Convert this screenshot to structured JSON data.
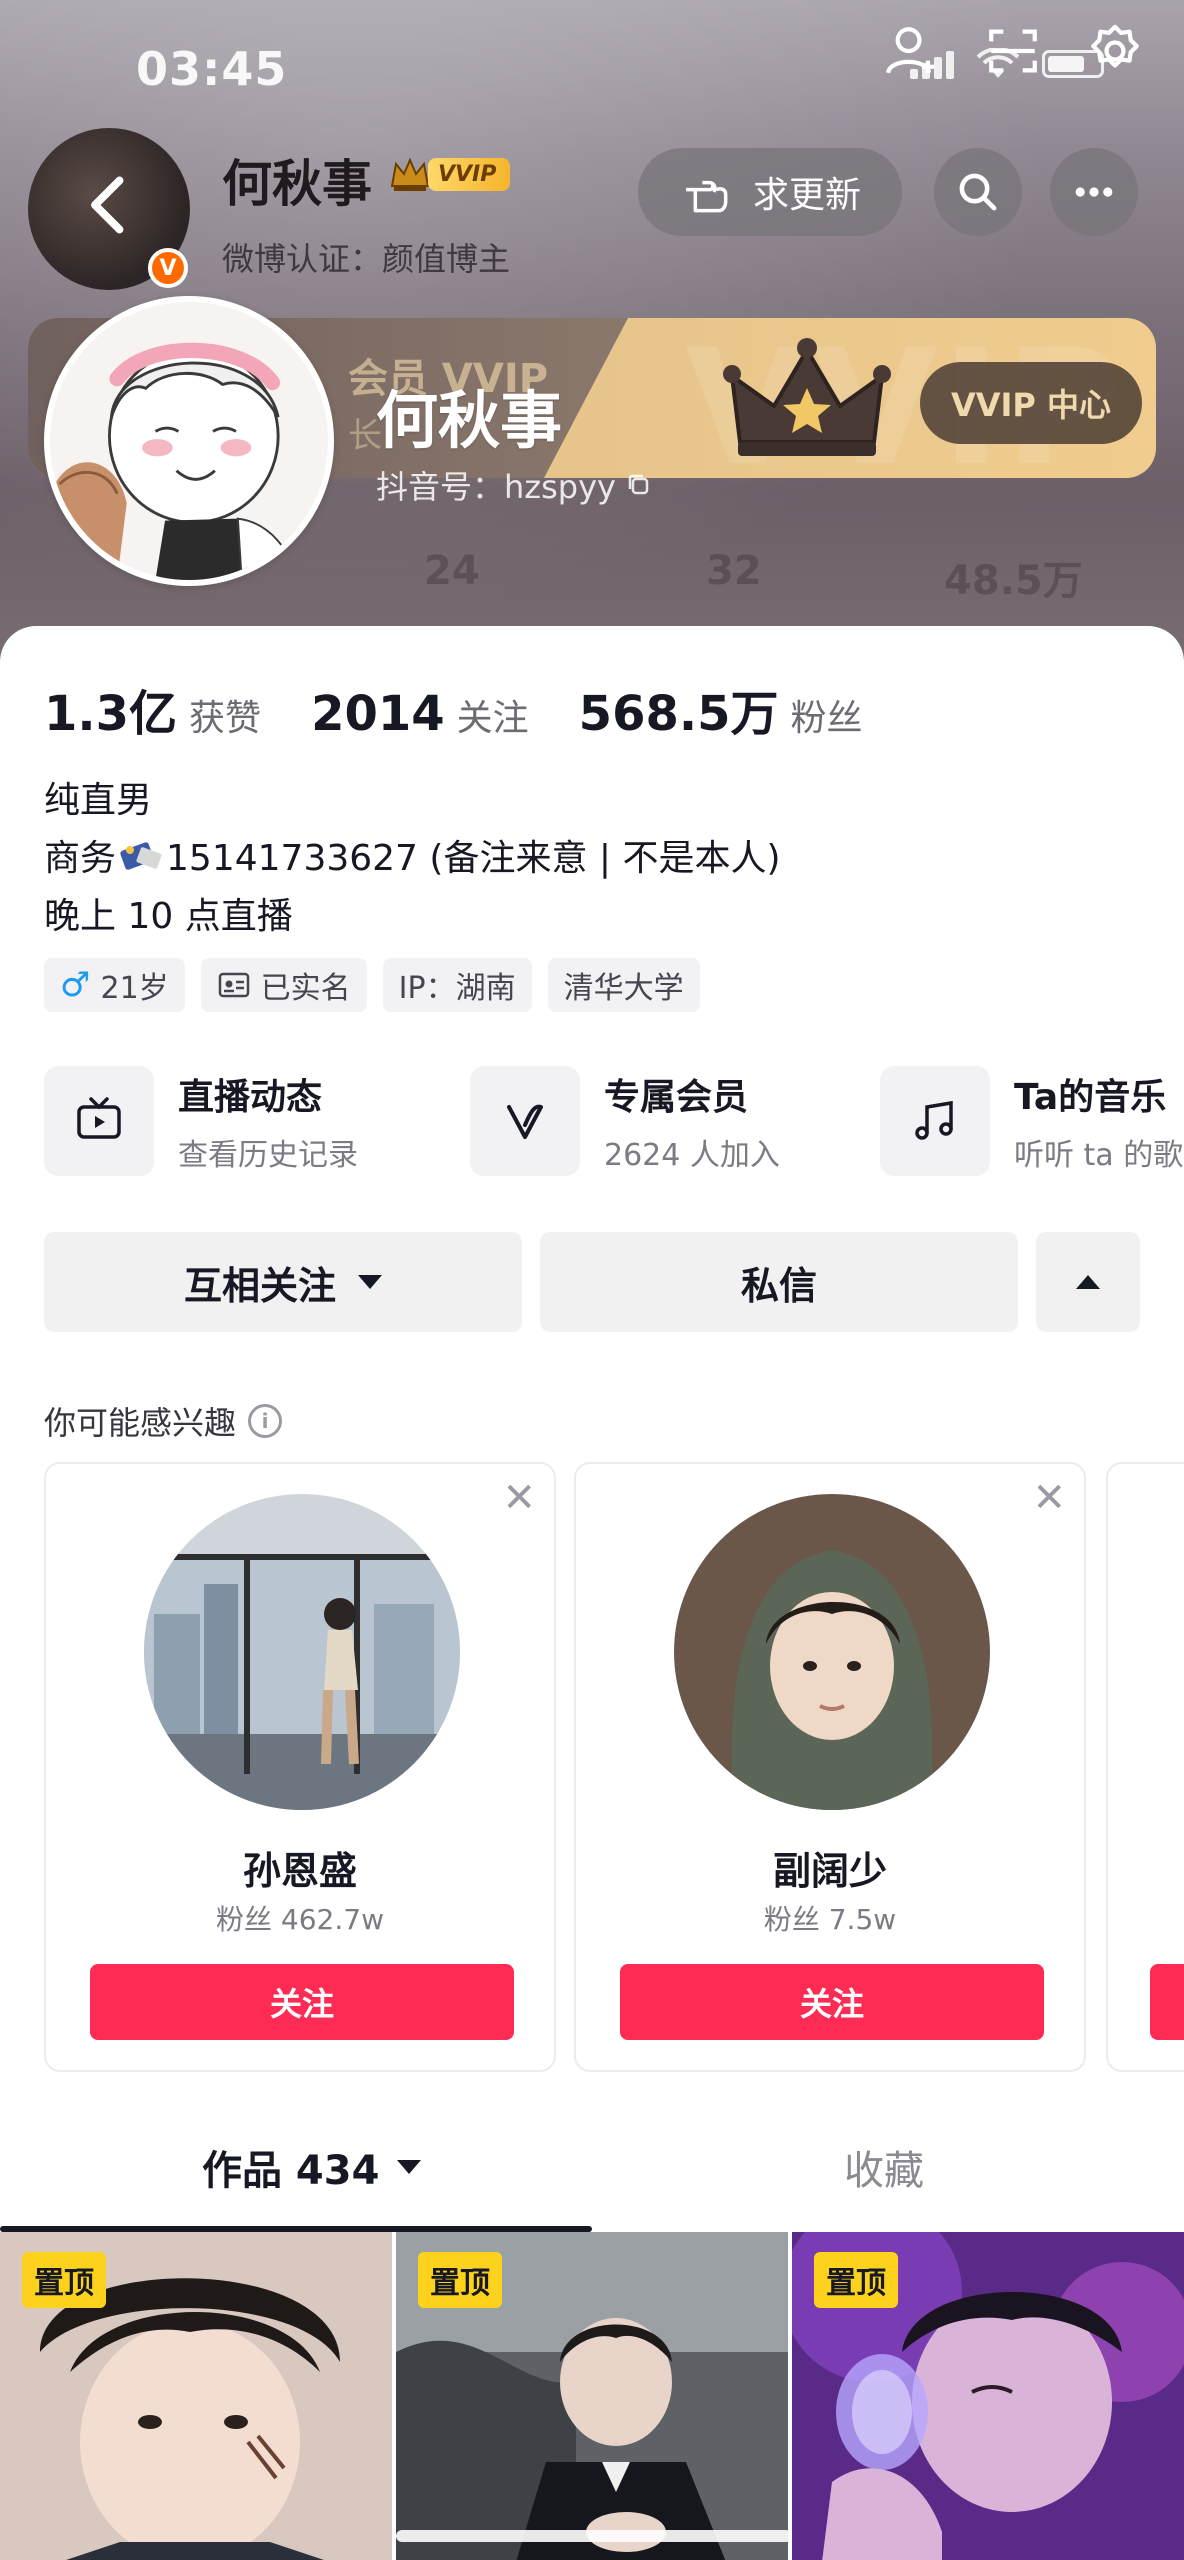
{
  "status_bar": {
    "time": "03:45"
  },
  "header": {
    "name": "何秋事",
    "vvip_badge": "VVIP",
    "weibo_cert": "微博认证：颜值博主",
    "update_button": "求更新",
    "douyin_id": "抖音号：hzspyy"
  },
  "vip_banner": {
    "bg_text": "会员 VVIP",
    "bg_text2": "长",
    "watermark": "VVIP",
    "center_button": "VVIP 中心",
    "faded_stats": [
      "24",
      "32",
      "48.5万"
    ]
  },
  "stats": [
    {
      "num": "1.3亿",
      "label": "获赞"
    },
    {
      "num": "2014",
      "label": "关注"
    },
    {
      "num": "568.5万",
      "label": "粉丝"
    }
  ],
  "bio": {
    "line1": "纯直男",
    "line2_prefix": "商务",
    "line2_rest": "15141733627 (备注来意 | 不是本人)",
    "line3": "晚上 10 点直播"
  },
  "tags": {
    "gender_symbol": "♂",
    "age": "21岁",
    "verified": "已实名",
    "ip": "IP：湖南",
    "school": "清华大学"
  },
  "features": [
    {
      "title": "直播动态",
      "sub": "查看历史记录",
      "icon": "tv-icon"
    },
    {
      "title": "专属会员",
      "sub": "2624 人加入",
      "icon": "v-icon"
    },
    {
      "title": "Ta的音乐",
      "sub": "听听 ta 的歌",
      "icon": "music-icon"
    }
  ],
  "actions": {
    "mutual_follow": "互相关注",
    "message": "私信"
  },
  "recommend": {
    "title": "你可能感兴趣",
    "cards": [
      {
        "name": "孙恩盛",
        "fans": "粉丝 462.7w",
        "follow": "关注"
      },
      {
        "name": "副阔少",
        "fans": "粉丝 7.5w",
        "follow": "关注"
      }
    ]
  },
  "tabs": {
    "works": "作品 434",
    "favorites": "收藏"
  },
  "grid": {
    "pin_label": "置顶"
  },
  "colors": {
    "accent": "#fe2c55",
    "pin": "#fcd21d",
    "vip_gold": "#f0cc8e"
  }
}
